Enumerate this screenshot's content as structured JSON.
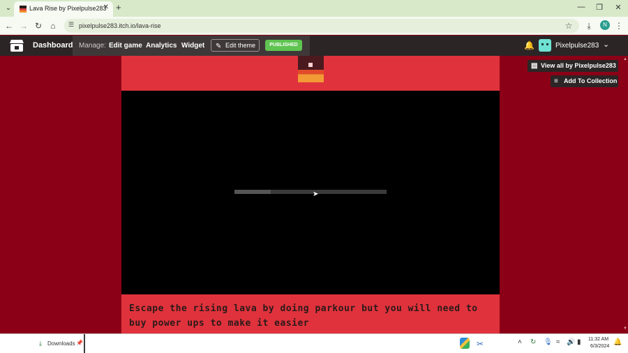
{
  "browser": {
    "tab_title": "Lava Rise by Pixelpulse283",
    "url": "pixelpulse283.itch.io/lava-rise",
    "profile_initial": "N"
  },
  "itch_bar": {
    "dashboard": "Dashboard",
    "manage_label": "Manage:",
    "edit_game": "Edit game",
    "analytics": "Analytics",
    "widget": "Widget",
    "edit_theme": "Edit theme",
    "published": "PUBLISHED",
    "username": "Pixelpulse283"
  },
  "page": {
    "view_all": "View all by Pixelpulse283",
    "add_to_collection": "Add To Collection",
    "description": "Escape the rising lava by doing parkour but you will need to buy power ups to make it easier",
    "loading_progress": 0.24
  },
  "shelf": {
    "downloads": "Downloads"
  },
  "taskbar": {
    "time": "11:32 AM",
    "date": "6/3/2024"
  },
  "colors": {
    "page_background": "#8b0016",
    "header_band": "#e0323c",
    "itch_bar": "#2b2526",
    "published_badge": "#5fc451"
  }
}
